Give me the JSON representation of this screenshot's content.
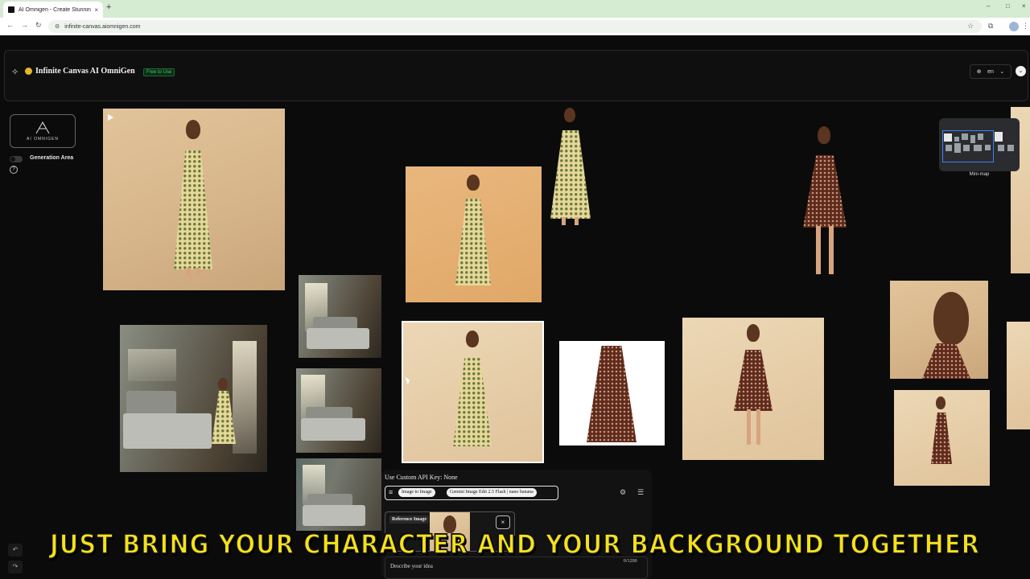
{
  "browser": {
    "tab_title": "AI Omnigen - Create Stunnin",
    "tab_close": "×",
    "new_tab": "+",
    "url": "infinite-canvas.aiomnigen.com",
    "window_controls": [
      "–",
      "□",
      "×"
    ]
  },
  "header": {
    "title": "Infinite Canvas AI OmniGen",
    "badge": "Free to Use",
    "language": "en"
  },
  "sidebar": {
    "logo_text": "AI OMNIGEN",
    "generation_area_label": "Generation Area",
    "help": "?"
  },
  "minimap": {
    "label": "Mini-map"
  },
  "prompt_panel": {
    "api_key_label": "Use Custom API Key: None",
    "mode": "Image to Image",
    "model": "Gemini Image Edit 2.5 Flash | nano banana",
    "reference_label": "Reference Image",
    "remove": "×",
    "placeholder": "Describe your idea",
    "char_count": "0/1200"
  },
  "caption": "JUST BRING YOUR CHARACTER AND YOUR BACKGROUND TOGETHER",
  "icons": {
    "back": "arrow-left-icon",
    "forward": "arrow-right-icon",
    "reload": "reload-icon",
    "star": "star-icon",
    "globe": "globe-icon",
    "play": "play-icon",
    "undo": "undo-icon",
    "redo": "redo-icon",
    "gear": "gear-icon",
    "sliders": "sliders-icon",
    "menu": "menu-icon"
  },
  "colors": {
    "caption": "#f5e11c",
    "badge": "#38d06a",
    "minimap_view": "#3b82f6",
    "tabbar": "#d5ebd2"
  }
}
